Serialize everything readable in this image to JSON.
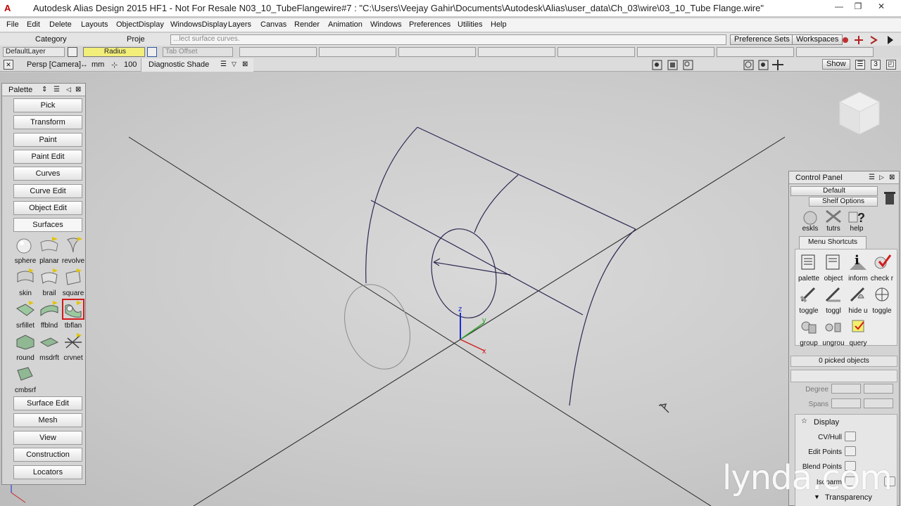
{
  "window": {
    "app_logo": "A",
    "title": "Autodesk Alias Design 2015 HF1 - Not For Resale    N03_10_TubeFlangewire#7 : \"C:\\Users\\Veejay Gahir\\Documents\\Autodesk\\Alias\\user_data\\Ch_03\\wire\\03_10_Tube Flange.wire\"",
    "controls": [
      "—",
      "❐",
      "✕"
    ]
  },
  "menu": [
    "File",
    "Edit",
    "Delete",
    "Layouts",
    "ObjectDisplay",
    "WindowsDisplay",
    "Layers",
    "Canvas",
    "Render",
    "Animation",
    "Windows",
    "Preferences",
    "Utilities",
    "Help"
  ],
  "toolbar1": {
    "category_label": "Category",
    "object_label": "Proje",
    "prompt": "...lect surface curves.",
    "preference_sets": "Preference Sets",
    "workspaces": "Workspaces"
  },
  "toolbar2": {
    "layer": "DefaultLayer",
    "radius_label": "Radius",
    "tab_offset": "Tab Offset"
  },
  "viewbar": {
    "camera": "Persp [Camera]",
    "units": "mm",
    "grid_value": "100",
    "shade_mode": "Diagnostic Shade",
    "show_button": "Show",
    "window_number": "3"
  },
  "palette": {
    "title": "Palette",
    "buttons_top": [
      "Pick",
      "Transform",
      "Paint",
      "Paint Edit",
      "Curves",
      "Curve Edit",
      "Object Edit"
    ],
    "open_section": "Surfaces",
    "tools": [
      {
        "label": "sphere",
        "icon": "sphere-icon"
      },
      {
        "label": "planar",
        "icon": "planar-icon"
      },
      {
        "label": "revolve",
        "icon": "revolve-icon"
      },
      {
        "label": "skin",
        "icon": "skin-icon"
      },
      {
        "label": "brail",
        "icon": "rail-icon"
      },
      {
        "label": "square",
        "icon": "square-icon"
      },
      {
        "label": "srfillet",
        "icon": "surface-fillet-icon"
      },
      {
        "label": "ffblnd",
        "icon": "freeform-blend-icon"
      },
      {
        "label": "tbflan",
        "icon": "tube-flange-icon",
        "selected": true
      },
      {
        "label": "round",
        "icon": "round-icon"
      },
      {
        "label": "msdrft",
        "icon": "multi-draft-icon"
      },
      {
        "label": "crvnet",
        "icon": "curve-network-icon"
      },
      {
        "label": "cmbsrf",
        "icon": "combine-surface-icon"
      }
    ],
    "buttons_bottom": [
      "Surface Edit",
      "Mesh",
      "View",
      "Construction",
      "Locators"
    ]
  },
  "control_panel": {
    "title": "Control Panel",
    "preset": "Default",
    "shelf_options": "Shelf Options",
    "shelf_tools": [
      {
        "label": "eskls",
        "icon": "eskls-icon"
      },
      {
        "label": "tutrs",
        "icon": "tutorials-icon"
      },
      {
        "label": "help",
        "icon": "help-icon"
      }
    ],
    "menu_shortcuts_tab": "Menu Shortcuts",
    "shortcuts": [
      {
        "label": "palette",
        "icon": "palette-icon"
      },
      {
        "label": "object",
        "icon": "object-icon"
      },
      {
        "label": "inform",
        "icon": "info-icon"
      },
      {
        "label": "check r",
        "icon": "check-icon"
      },
      {
        "label": "toggle",
        "icon": "toggle-icon"
      },
      {
        "label": "toggl",
        "icon": "toggle-icon"
      },
      {
        "label": "hide u",
        "icon": "hide-icon"
      },
      {
        "label": "toggle",
        "icon": "toggle-icon"
      },
      {
        "label": "group",
        "icon": "group-icon"
      },
      {
        "label": "ungrou",
        "icon": "ungroup-icon"
      },
      {
        "label": "query",
        "icon": "query-icon"
      }
    ],
    "picked_objects": "0 picked objects",
    "degree_label": "Degree",
    "spans_label": "Spans",
    "display_section": "Display",
    "display_options": [
      "CV/Hull",
      "Edit Points",
      "Blend Points",
      "Isoparm"
    ],
    "transparency": "Transparency"
  },
  "axis_labels": {
    "z": "z",
    "y": "y",
    "x": "x"
  },
  "watermark": "lynda.com",
  "colors": {
    "viewport_bg": "#c9c9c9",
    "curve": "#2f2752",
    "selected_tool_outline": "#d31a1a",
    "radius_field": "#f2ee7a"
  }
}
